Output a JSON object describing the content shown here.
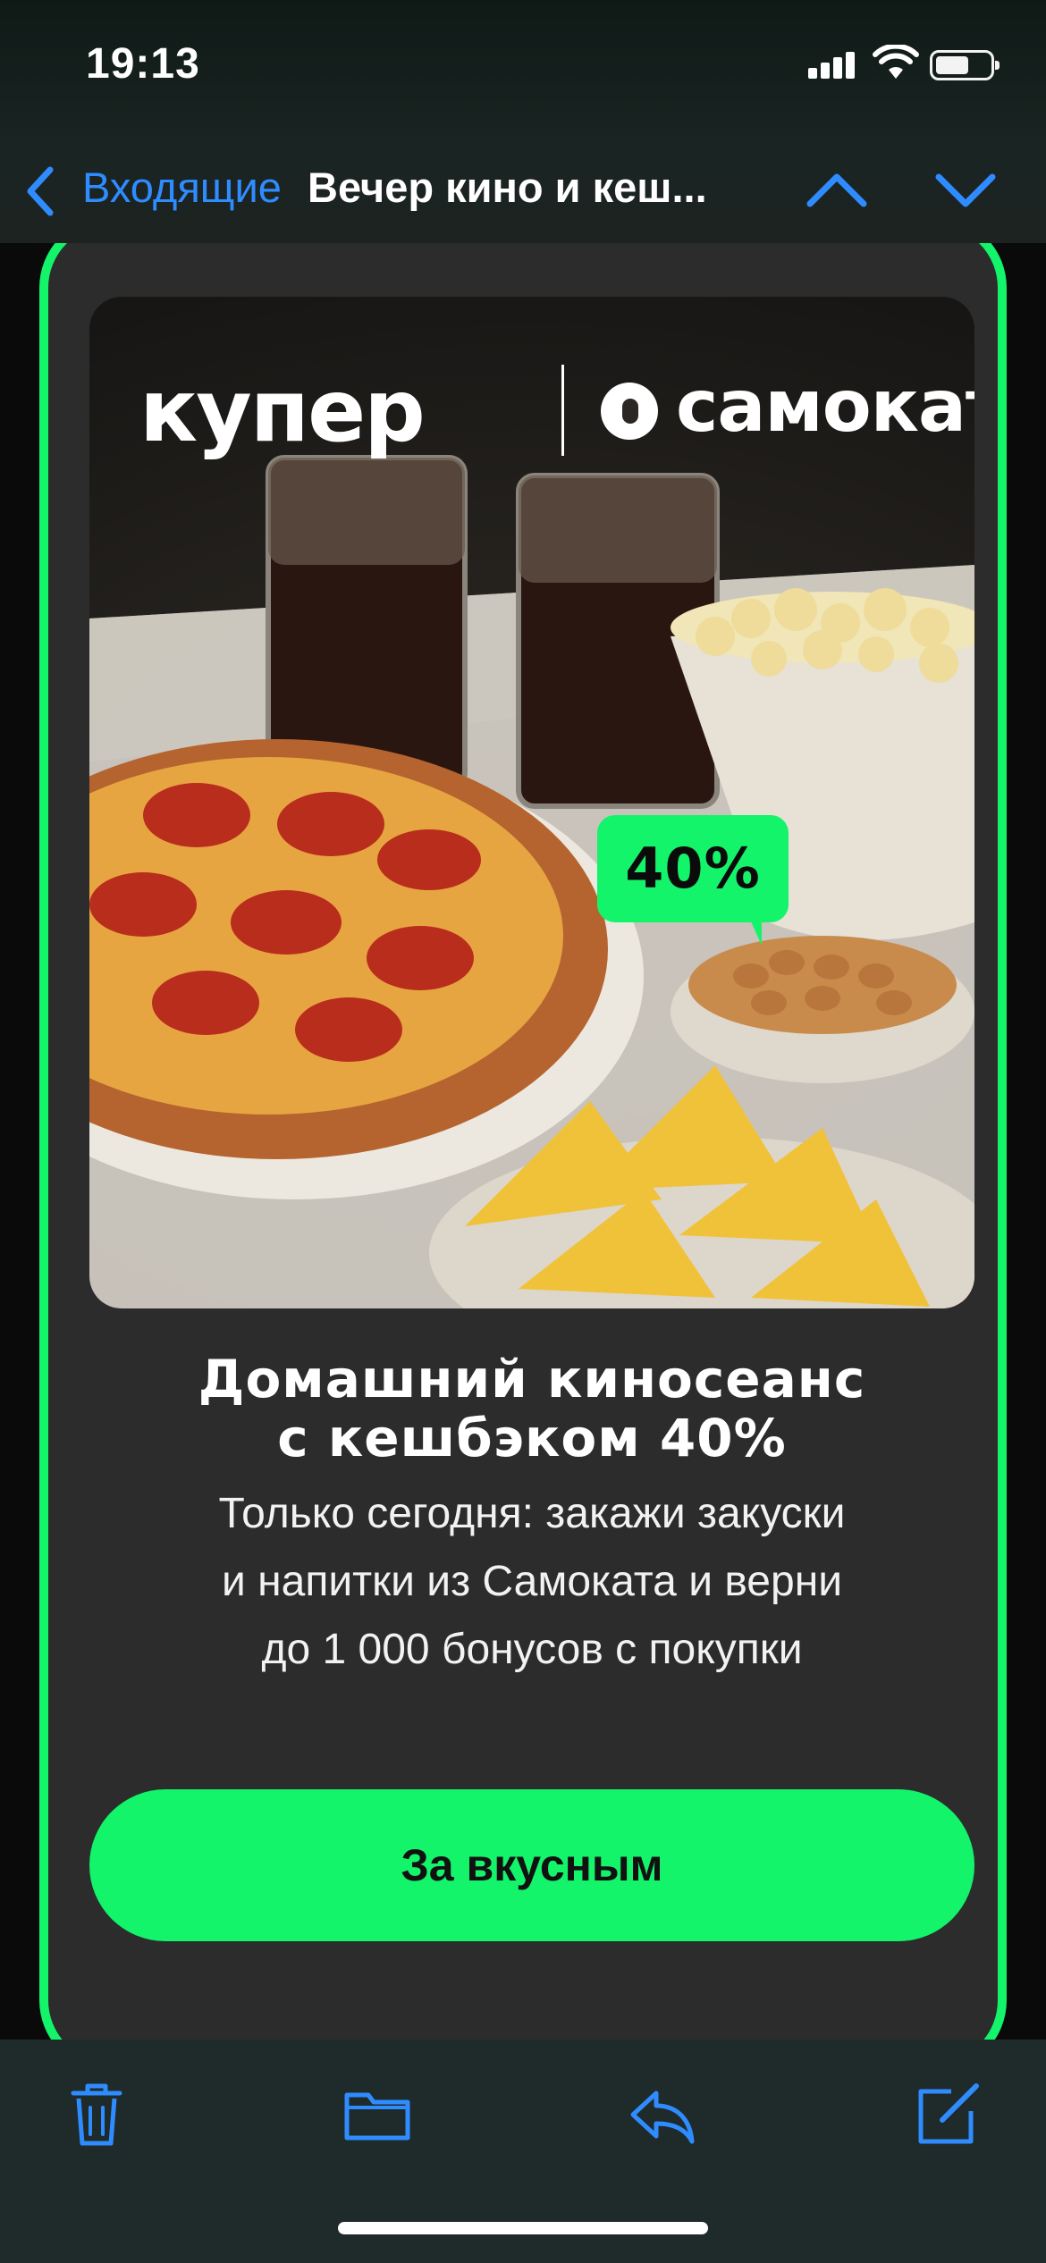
{
  "status_bar": {
    "time": "19:13"
  },
  "nav": {
    "back_label": "Входящие",
    "title": "Вечер кино и кеш...",
    "up_icon": "chevron-up-icon",
    "down_icon": "chevron-down-icon"
  },
  "email": {
    "brand_left": "купер",
    "brand_right": "самокат",
    "badge": "40%",
    "headline_line1": "Домашний киносеанс",
    "headline_line2": "с кешбэком 40%",
    "body_line1": "Только сегодня: закажи закуски",
    "body_line2": "и напитки из Самоката и верни",
    "body_line3": "до 1 000 бонусов с покупки",
    "cta": "За вкусным",
    "accent_color": "#13f46a"
  },
  "toolbar": {
    "items": [
      "trash-icon",
      "folder-icon",
      "reply-icon",
      "compose-icon"
    ],
    "icon_color": "#2f8cff"
  }
}
